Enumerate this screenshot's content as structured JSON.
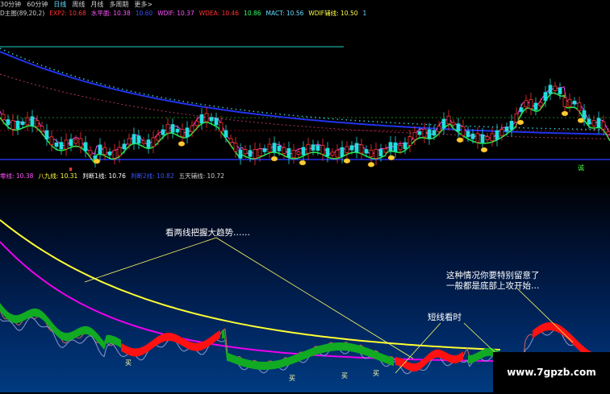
{
  "tabs": [
    {
      "label": "30分钟",
      "active": false
    },
    {
      "label": "60分钟",
      "active": false
    },
    {
      "label": "日线",
      "active": true
    },
    {
      "label": "周线",
      "active": false
    },
    {
      "label": "月线",
      "active": false
    },
    {
      "label": "多周期",
      "active": false
    },
    {
      "label": "更多>",
      "active": false
    }
  ],
  "top_indicators": [
    {
      "label": "D主图(89,20,2)",
      "color": "#d0d0d0"
    },
    {
      "label": "EXP2: 10.68",
      "color": "#ff3333"
    },
    {
      "label": "水平面: 10.38",
      "color": "#ff55ff"
    },
    {
      "label": "10.60",
      "color": "#3355ff"
    },
    {
      "label": "WDIF: 10.37",
      "color": "#ff55ff"
    },
    {
      "label": "WDEA: 10.46",
      "color": "#ff3333"
    },
    {
      "label": "10.86",
      "color": "#33ff66"
    },
    {
      "label": "MACT: 10.56",
      "color": "#66ddff"
    },
    {
      "label": "WDIF辅线: 10.50",
      "color": "#ffff44"
    },
    {
      "label": "1",
      "color": "#66ddff"
    }
  ],
  "mid_indicators": [
    {
      "label": "零线: 10.38",
      "color": "#ff55ff"
    },
    {
      "label": "八九线: 10.31",
      "color": "#ffff44"
    },
    {
      "label": "判断1线: 10.76",
      "color": "#ffffff"
    },
    {
      "label": "判断2线: 10.82",
      "color": "#3355ff"
    },
    {
      "label": "五天辅线: 10.72",
      "color": "#cfcfcf"
    }
  ],
  "annotations": {
    "trend": "看两线把握大趋势……",
    "short": "短线看时",
    "special_line1": "这种情况你要特别留意了",
    "special_line2": "一般都是底部上攻开始…"
  },
  "buy_markers": {
    "label": "买",
    "top_label": "诚"
  },
  "watermark": "www.7gpzb.com",
  "colors": {
    "yellow_line": "#ffff33",
    "magenta_line": "#ee00ee",
    "blue_line": "#2233ee",
    "cyan_dots": "#33ccdd",
    "green_band": "#11aa22",
    "red_band": "#ff1111",
    "up_candle": "#ff3333",
    "down_candle": "#22dddd"
  }
}
